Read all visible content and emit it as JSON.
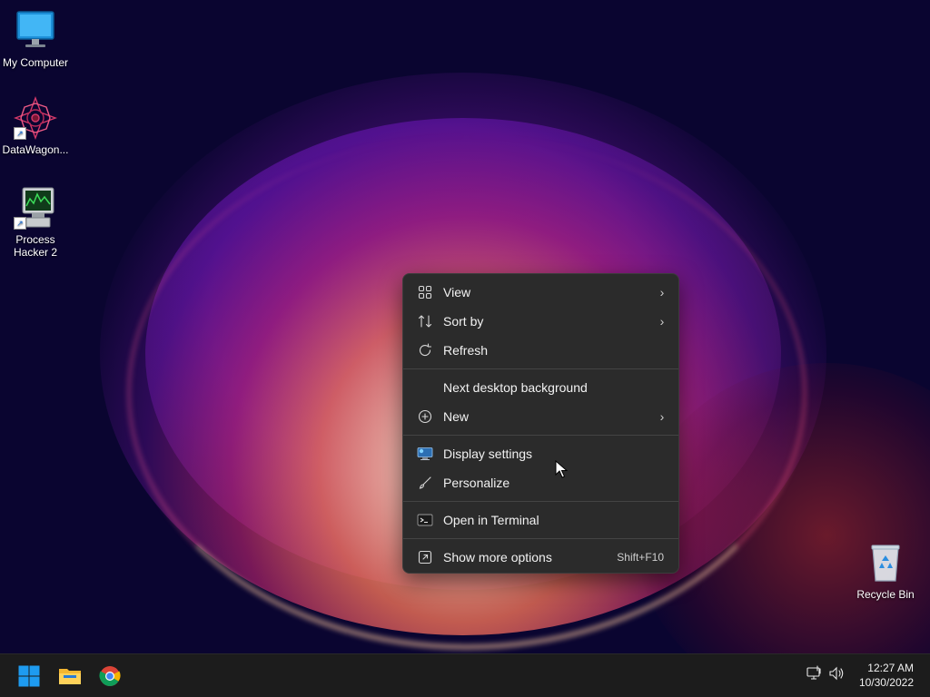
{
  "desktop": {
    "icons": [
      {
        "label": "My Computer",
        "icon": "monitor-icon"
      },
      {
        "label": "DataWagon...",
        "icon": "datawagon-icon"
      },
      {
        "label": "Process\nHacker 2",
        "icon": "process-hacker-icon"
      },
      {
        "label": "Recycle Bin",
        "icon": "recycle-bin-icon"
      }
    ]
  },
  "context_menu": {
    "items": [
      {
        "label": "View",
        "icon": "grid-icon",
        "submenu": true
      },
      {
        "label": "Sort by",
        "icon": "sort-icon",
        "submenu": true
      },
      {
        "label": "Refresh",
        "icon": "refresh-icon",
        "submenu": false
      },
      {
        "label": "Next desktop background",
        "icon": "",
        "submenu": false
      },
      {
        "label": "New",
        "icon": "plus-circle-icon",
        "submenu": true
      },
      {
        "label": "Display settings",
        "icon": "display-icon",
        "submenu": false
      },
      {
        "label": "Personalize",
        "icon": "brush-icon",
        "submenu": false
      },
      {
        "label": "Open in Terminal",
        "icon": "terminal-icon",
        "submenu": false
      },
      {
        "label": "Show more options",
        "icon": "more-options-icon",
        "shortcut": "Shift+F10"
      }
    ]
  },
  "taskbar": {
    "apps": [
      {
        "name": "Start",
        "icon": "windows-start-icon"
      },
      {
        "name": "File Explorer",
        "icon": "folder-icon"
      },
      {
        "name": "Google Chrome",
        "icon": "chrome-icon"
      }
    ],
    "tray": {
      "network_icon": "network-icon",
      "volume_icon": "volume-icon"
    },
    "clock": {
      "time": "12:27 AM",
      "date": "10/30/2022"
    }
  },
  "colors": {
    "menu_bg": "#2b2b2b",
    "taskbar_bg": "#1c1c1c",
    "windows_blue": "#1e9bf0"
  }
}
